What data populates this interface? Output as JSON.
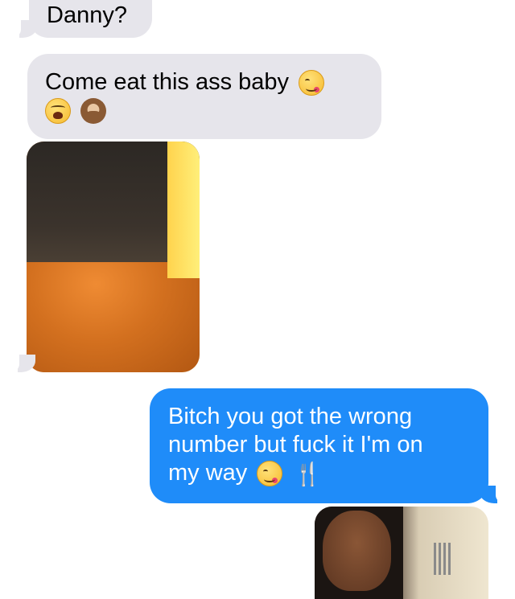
{
  "messages": [
    {
      "type": "incoming_text",
      "text": "Danny?"
    },
    {
      "type": "incoming_text",
      "text": "Come eat this ass baby",
      "emojis": [
        "face-savoring-food-icon",
        "weary-face-icon",
        "see-no-evil-monkey-icon"
      ]
    },
    {
      "type": "incoming_photo",
      "description_icon": "photo-thumbnail"
    },
    {
      "type": "outgoing_text",
      "lines": [
        "Bitch you got the wrong",
        "number but fuck it I'm on",
        "my way"
      ],
      "emojis": [
        "face-savoring-food-icon",
        "fork-and-knife-icon"
      ]
    },
    {
      "type": "outgoing_photo",
      "description_icon": "photo-thumbnail"
    }
  ],
  "colors": {
    "incoming_bubble": "#e6e5eb",
    "outgoing_bubble": "#1f8cf9",
    "background": "#ffffff"
  },
  "glyphs": {
    "fork_knife": "🍴"
  }
}
